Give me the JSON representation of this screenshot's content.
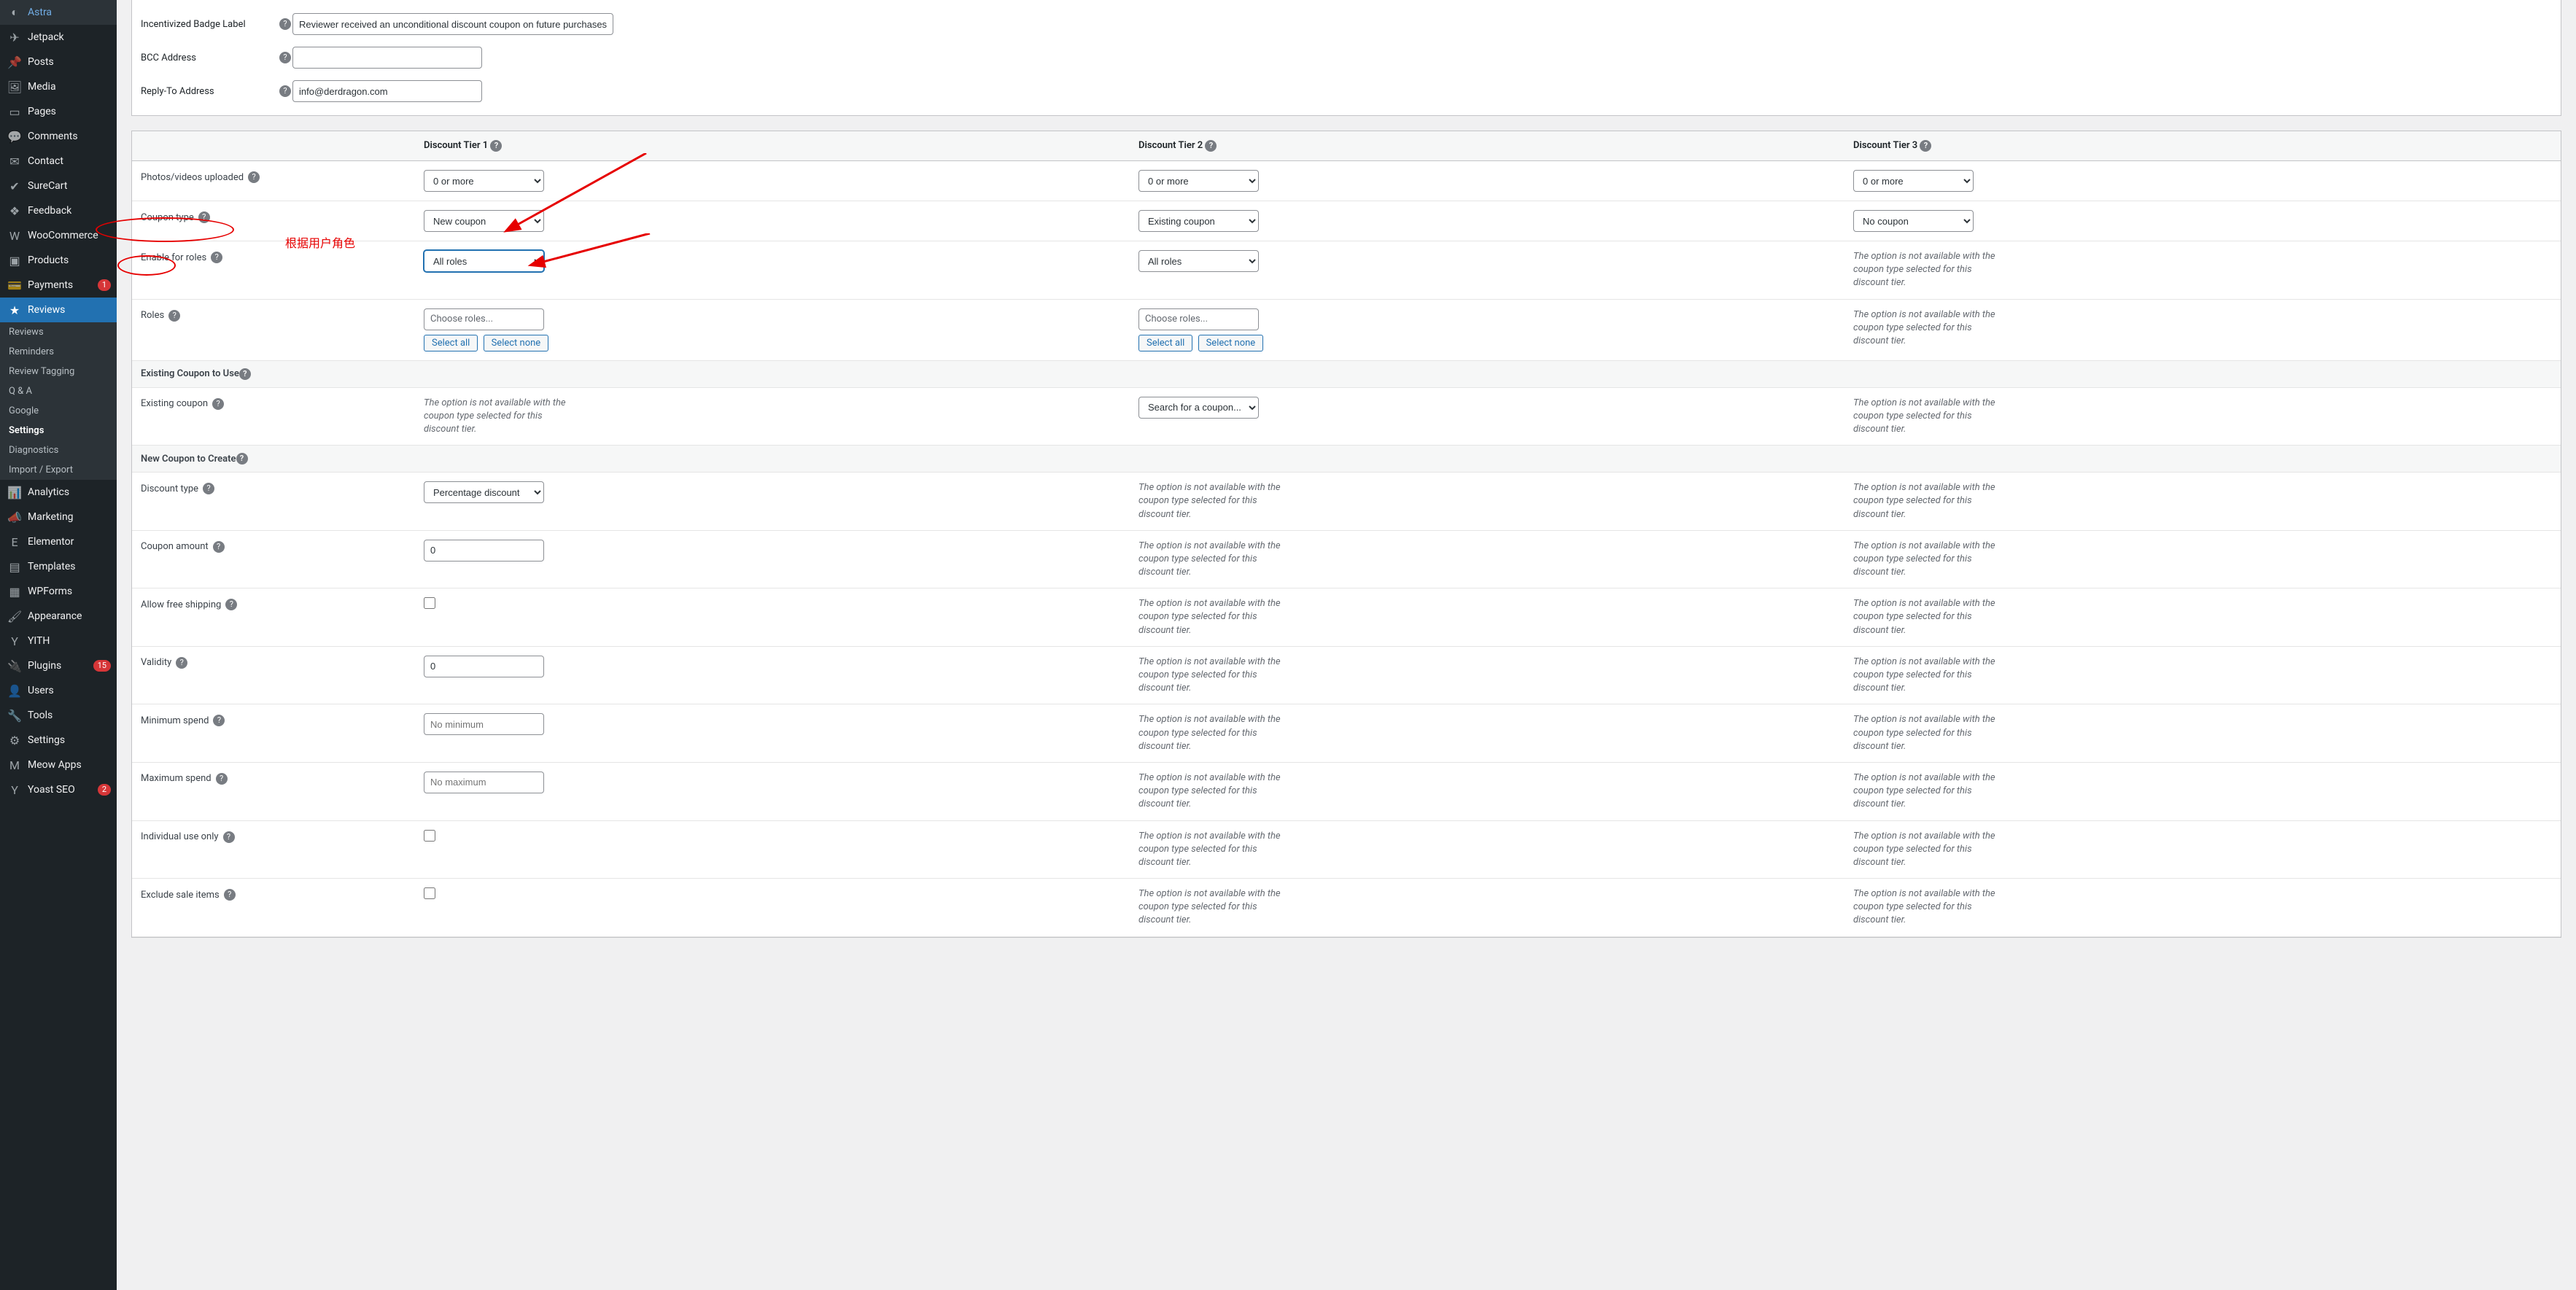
{
  "sidebar": {
    "items": [
      {
        "label": "Astra",
        "icon": "◐"
      },
      {
        "label": "Jetpack",
        "icon": "✈"
      },
      {
        "label": "Posts",
        "icon": "📌"
      },
      {
        "label": "Media",
        "icon": "🖼"
      },
      {
        "label": "Pages",
        "icon": "▭"
      },
      {
        "label": "Comments",
        "icon": "💬"
      },
      {
        "label": "Contact",
        "icon": "✉"
      },
      {
        "label": "SureCart",
        "icon": "✔"
      },
      {
        "label": "Feedback",
        "icon": "❖"
      },
      {
        "label": "WooCommerce",
        "icon": "W"
      },
      {
        "label": "Products",
        "icon": "▣"
      },
      {
        "label": "Payments",
        "icon": "💳",
        "badge": "1"
      },
      {
        "label": "Reviews",
        "icon": "★",
        "active": true
      },
      {
        "label": "Analytics",
        "icon": "📊"
      },
      {
        "label": "Marketing",
        "icon": "📣"
      },
      {
        "label": "Elementor",
        "icon": "E"
      },
      {
        "label": "Templates",
        "icon": "▤"
      },
      {
        "label": "WPForms",
        "icon": "▦"
      },
      {
        "label": "Appearance",
        "icon": "🖌"
      },
      {
        "label": "YITH",
        "icon": "Y"
      },
      {
        "label": "Plugins",
        "icon": "🔌",
        "badge": "15"
      },
      {
        "label": "Users",
        "icon": "👤"
      },
      {
        "label": "Tools",
        "icon": "🔧"
      },
      {
        "label": "Settings",
        "icon": "⚙"
      },
      {
        "label": "Meow Apps",
        "icon": "M"
      },
      {
        "label": "Yoast SEO",
        "icon": "Y",
        "badge": "2"
      }
    ],
    "sub": [
      {
        "label": "Reviews"
      },
      {
        "label": "Reminders"
      },
      {
        "label": "Review Tagging"
      },
      {
        "label": "Q & A"
      },
      {
        "label": "Google"
      },
      {
        "label": "Settings",
        "cur": true
      },
      {
        "label": "Diagnostics"
      },
      {
        "label": "Import / Export"
      }
    ]
  },
  "top": {
    "badge_label_lbl": "Incentivized Badge Label",
    "badge_label_val": "Reviewer received an unconditional discount coupon on future purchases",
    "bcc_lbl": "BCC Address",
    "bcc_val": "",
    "reply_lbl": "Reply-To Address",
    "reply_val": "info@derdragon.com"
  },
  "tiers": {
    "h1": "Discount Tier 1",
    "h2": "Discount Tier 2",
    "h3": "Discount Tier 3"
  },
  "rows": {
    "photos": "Photos/videos uploaded",
    "coupon_type": "Coupon type",
    "enable_roles": "Enable for roles",
    "roles": "Roles",
    "existing_hdr": "Existing Coupon to Use",
    "existing": "Existing coupon",
    "new_hdr": "New Coupon to Create",
    "disc_type": "Discount type",
    "amount": "Coupon amount",
    "free_ship": "Allow free shipping",
    "validity": "Validity",
    "min_spend": "Minimum spend",
    "max_spend": "Maximum spend",
    "indiv": "Individual use only",
    "excl": "Exclude sale items"
  },
  "vals": {
    "zero_more": "0 or more",
    "new_coupon": "New coupon",
    "existing_coupon": "Existing coupon",
    "no_coupon": "No coupon",
    "all_roles": "All roles",
    "choose_roles": "Choose roles...",
    "select_all": "Select all",
    "select_none": "Select none",
    "search_coupon": "Search for a coupon...",
    "perc_disc": "Percentage discount",
    "zero": "0",
    "no_min": "No minimum",
    "no_max": "No maximum",
    "na": "The option is not available with the coupon type selected for this discount tier."
  },
  "anno": {
    "text": "根据用户角色"
  }
}
